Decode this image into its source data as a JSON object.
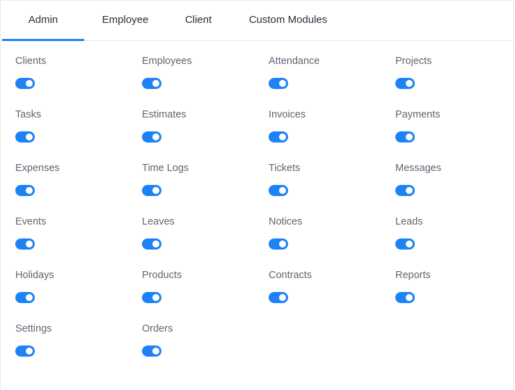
{
  "tabs": [
    {
      "label": "Admin",
      "active": true
    },
    {
      "label": "Employee",
      "active": false
    },
    {
      "label": "Client",
      "active": false
    },
    {
      "label": "Custom Modules",
      "active": false
    }
  ],
  "accent_color": "#1d82f5",
  "modules": [
    {
      "label": "Clients",
      "enabled": true
    },
    {
      "label": "Employees",
      "enabled": true
    },
    {
      "label": "Attendance",
      "enabled": true
    },
    {
      "label": "Projects",
      "enabled": true
    },
    {
      "label": "Tasks",
      "enabled": true
    },
    {
      "label": "Estimates",
      "enabled": true
    },
    {
      "label": "Invoices",
      "enabled": true
    },
    {
      "label": "Payments",
      "enabled": true
    },
    {
      "label": "Expenses",
      "enabled": true
    },
    {
      "label": "Time Logs",
      "enabled": true
    },
    {
      "label": "Tickets",
      "enabled": true
    },
    {
      "label": "Messages",
      "enabled": true
    },
    {
      "label": "Events",
      "enabled": true
    },
    {
      "label": "Leaves",
      "enabled": true
    },
    {
      "label": "Notices",
      "enabled": true
    },
    {
      "label": "Leads",
      "enabled": true
    },
    {
      "label": "Holidays",
      "enabled": true
    },
    {
      "label": "Products",
      "enabled": true
    },
    {
      "label": "Contracts",
      "enabled": true
    },
    {
      "label": "Reports",
      "enabled": true
    },
    {
      "label": "Settings",
      "enabled": true
    },
    {
      "label": "Orders",
      "enabled": true
    }
  ]
}
